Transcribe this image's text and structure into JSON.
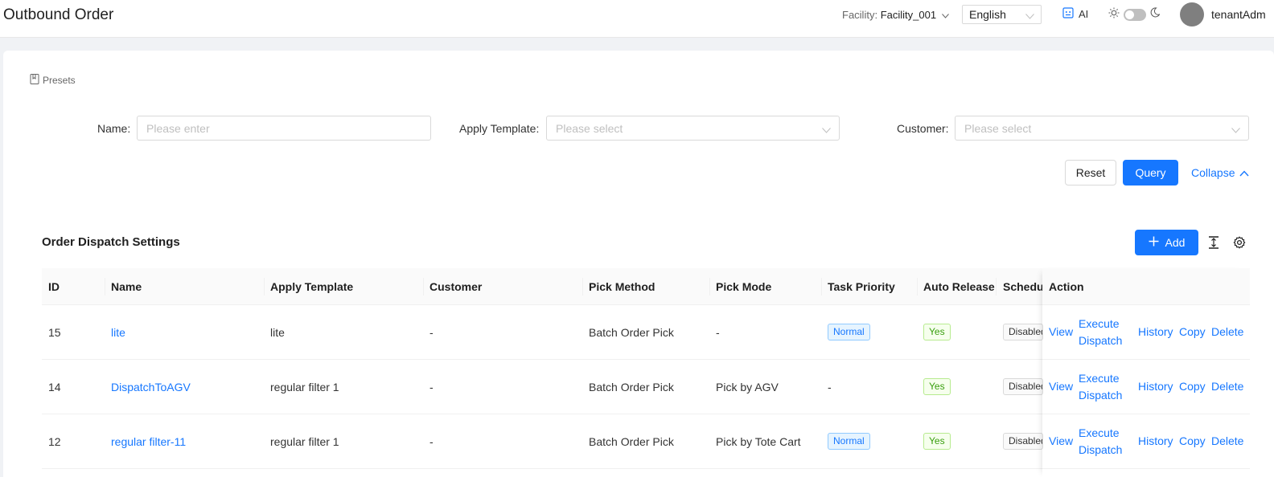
{
  "header": {
    "title": "Outbound Order",
    "facility_label": "Facility:",
    "facility_value": "Facility_001",
    "language": "English",
    "ai_label": "AI",
    "username": "tenantAdm"
  },
  "filters": {
    "presets_label": "Presets",
    "name_label": "Name:",
    "name_placeholder": "Please enter",
    "template_label": "Apply Template:",
    "template_placeholder": "Please select",
    "customer_label": "Customer:",
    "customer_placeholder": "Please select",
    "reset_label": "Reset",
    "query_label": "Query",
    "collapse_label": "Collapse"
  },
  "section": {
    "title": "Order Dispatch Settings",
    "add_label": "Add"
  },
  "table": {
    "columns": [
      "ID",
      "Name",
      "Apply Template",
      "Customer",
      "Pick Method",
      "Pick Mode",
      "Task Priority",
      "Auto Release",
      "Schedul",
      "Action"
    ],
    "rows": [
      {
        "id": "15",
        "name": "lite",
        "template": "lite",
        "customer": "-",
        "pick_method": "Batch Order Pick",
        "pick_mode": "-",
        "priority": "Normal",
        "auto_release": "Yes",
        "schedule": "Disabled"
      },
      {
        "id": "14",
        "name": "DispatchToAGV",
        "template": "regular filter 1",
        "customer": "-",
        "pick_method": "Batch Order Pick",
        "pick_mode": "Pick by AGV",
        "priority": "-",
        "auto_release": "Yes",
        "schedule": "Disabled"
      },
      {
        "id": "12",
        "name": "regular filter-11",
        "template": "regular filter 1",
        "customer": "-",
        "pick_method": "Batch Order Pick",
        "pick_mode": "Pick by Tote Cart",
        "priority": "Normal",
        "auto_release": "Yes",
        "schedule": "Disabled"
      }
    ],
    "actions": {
      "view": "View",
      "execute_1": "Execute",
      "execute_2": "Dispatch",
      "history": "History",
      "copy": "Copy",
      "delete": "Delete"
    }
  },
  "colors": {
    "primary": "#1677ff",
    "success": "#389e0d"
  }
}
